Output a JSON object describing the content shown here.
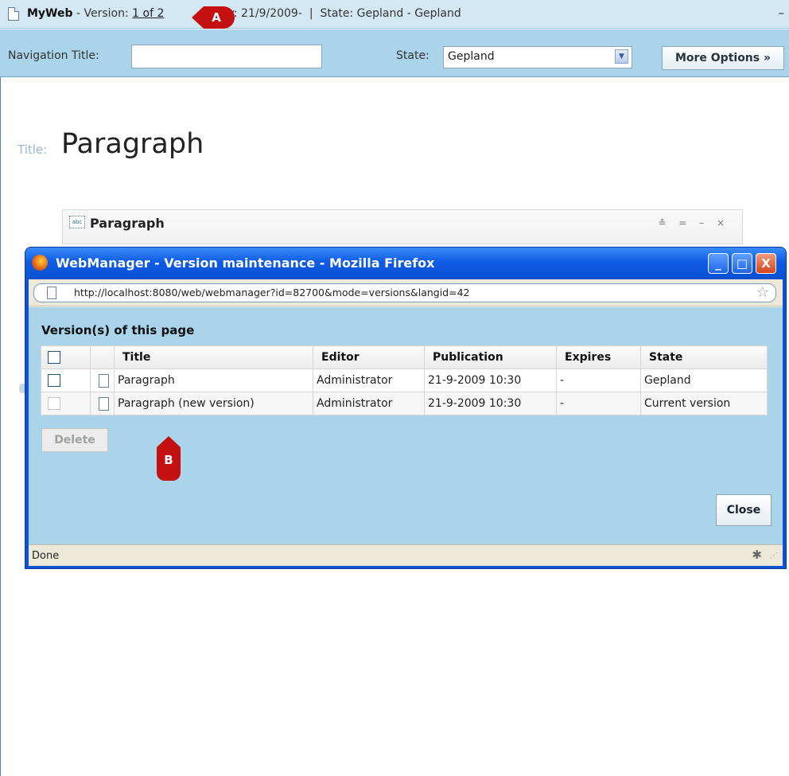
{
  "topbar": {
    "site": "MyWeb",
    "version_label": " - Version: ",
    "version_link": "1 of 2",
    "validity": "dity: 21/9/2009-",
    "separator": "|",
    "state_text": "State: Gepland - Gepland",
    "collapse": "–"
  },
  "navbar": {
    "nav_title_label": "Navigation Title:",
    "nav_title_value": "",
    "state_label": "State:",
    "state_value": "Gepland",
    "more_options": "More Options »"
  },
  "page": {
    "title_label": "Title:",
    "title_value": "Paragraph",
    "paragraph_box_icon": "abc",
    "paragraph_box_title": "Paragraph",
    "paragraph_box_controls": "≗ = – ×"
  },
  "firefox": {
    "window_title": "WebManager - Version maintenance - Mozilla Firefox",
    "url": "http://localhost:8080/web/webmanager?id=82700&mode=versions&langid=42",
    "status": "Done",
    "buttons": {
      "minimize": "_",
      "maximize": "□",
      "close": "X"
    }
  },
  "versions": {
    "heading": "Version(s) of this page",
    "columns": [
      "Title",
      "Editor",
      "Publication",
      "Expires",
      "State"
    ],
    "rows": [
      {
        "title": "Paragraph",
        "editor": "Administrator",
        "publication": "21-9-2009 10:30",
        "expires": "-",
        "state": "Gepland",
        "checkbox_enabled": true
      },
      {
        "title": "Paragraph (new version)",
        "editor": "Administrator",
        "publication": "21-9-2009 10:30",
        "expires": "-",
        "state": "Current version",
        "checkbox_enabled": false
      }
    ],
    "delete_label": "Delete",
    "close_label": "Close"
  },
  "callouts": {
    "a": "A",
    "b": "B"
  },
  "colors": {
    "titlebar_blue": "#0a53d4",
    "content_bg": "#a9d4ea",
    "callout_red": "#c41010"
  }
}
